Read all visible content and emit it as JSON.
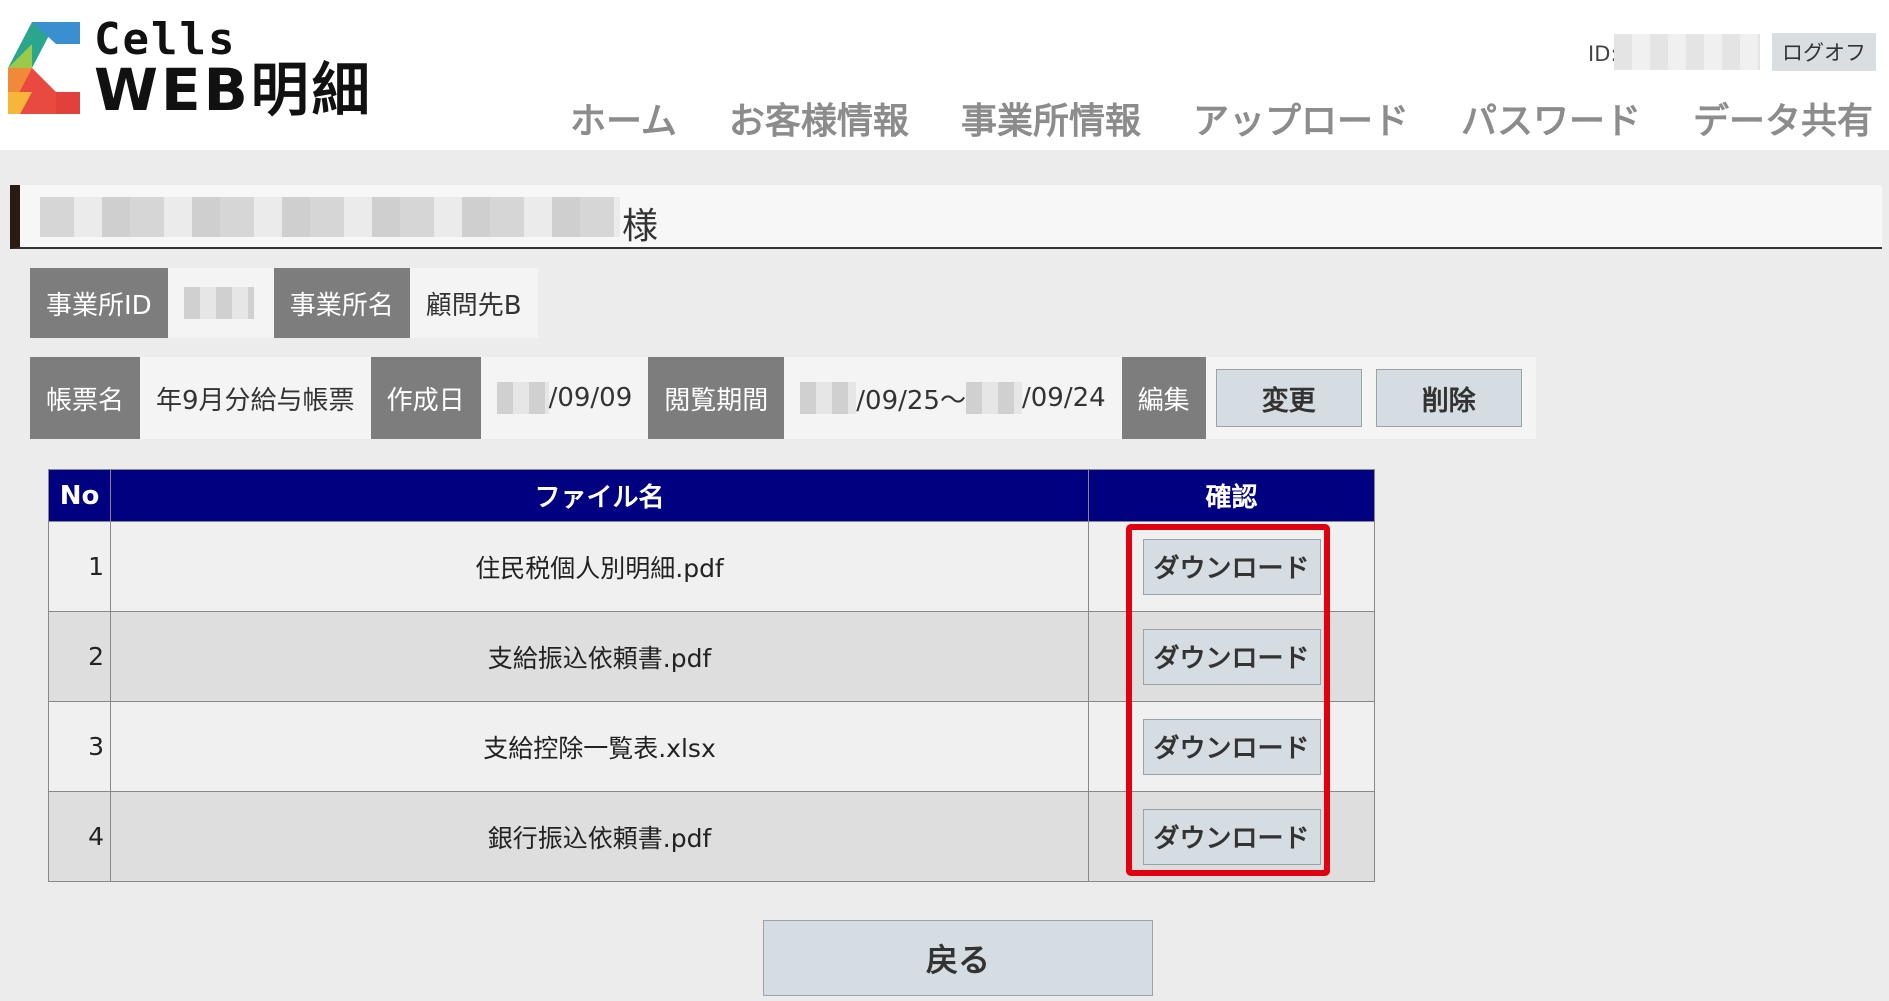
{
  "logo": {
    "line1": "Cells",
    "line2": "WEB明細"
  },
  "header": {
    "id_label": "ID:",
    "logout_label": "ログオフ",
    "nav": [
      "ホーム",
      "お客様情報",
      "事業所情報",
      "アップロード",
      "パスワード",
      "データ共有"
    ]
  },
  "customer": {
    "suffix": "様"
  },
  "office": {
    "id_label": "事業所ID",
    "name_label": "事業所名",
    "name_value": "顧問先B"
  },
  "form": {
    "name_label": "帳票名",
    "name_value": "年9月分給与帳票",
    "created_label": "作成日",
    "created_value": "/09/09",
    "period_label": "閲覧期間",
    "period_start": "/09/25〜",
    "period_end": "/09/24",
    "edit_label": "編集",
    "change_label": "変更",
    "delete_label": "削除"
  },
  "table": {
    "headers": [
      "No",
      "ファイル名",
      "確認"
    ],
    "rows": [
      {
        "no": "1",
        "file": "住民税個人別明細.pdf",
        "action": "ダウンロード"
      },
      {
        "no": "2",
        "file": "支給振込依頼書.pdf",
        "action": "ダウンロード"
      },
      {
        "no": "3",
        "file": "支給控除一覧表.xlsx",
        "action": "ダウンロード"
      },
      {
        "no": "4",
        "file": "銀行振込依頼書.pdf",
        "action": "ダウンロード"
      }
    ]
  },
  "back_label": "戻る",
  "colors": {
    "table_header": "#000080",
    "highlight": "#e00010",
    "label_bg": "#7d7d7d"
  }
}
